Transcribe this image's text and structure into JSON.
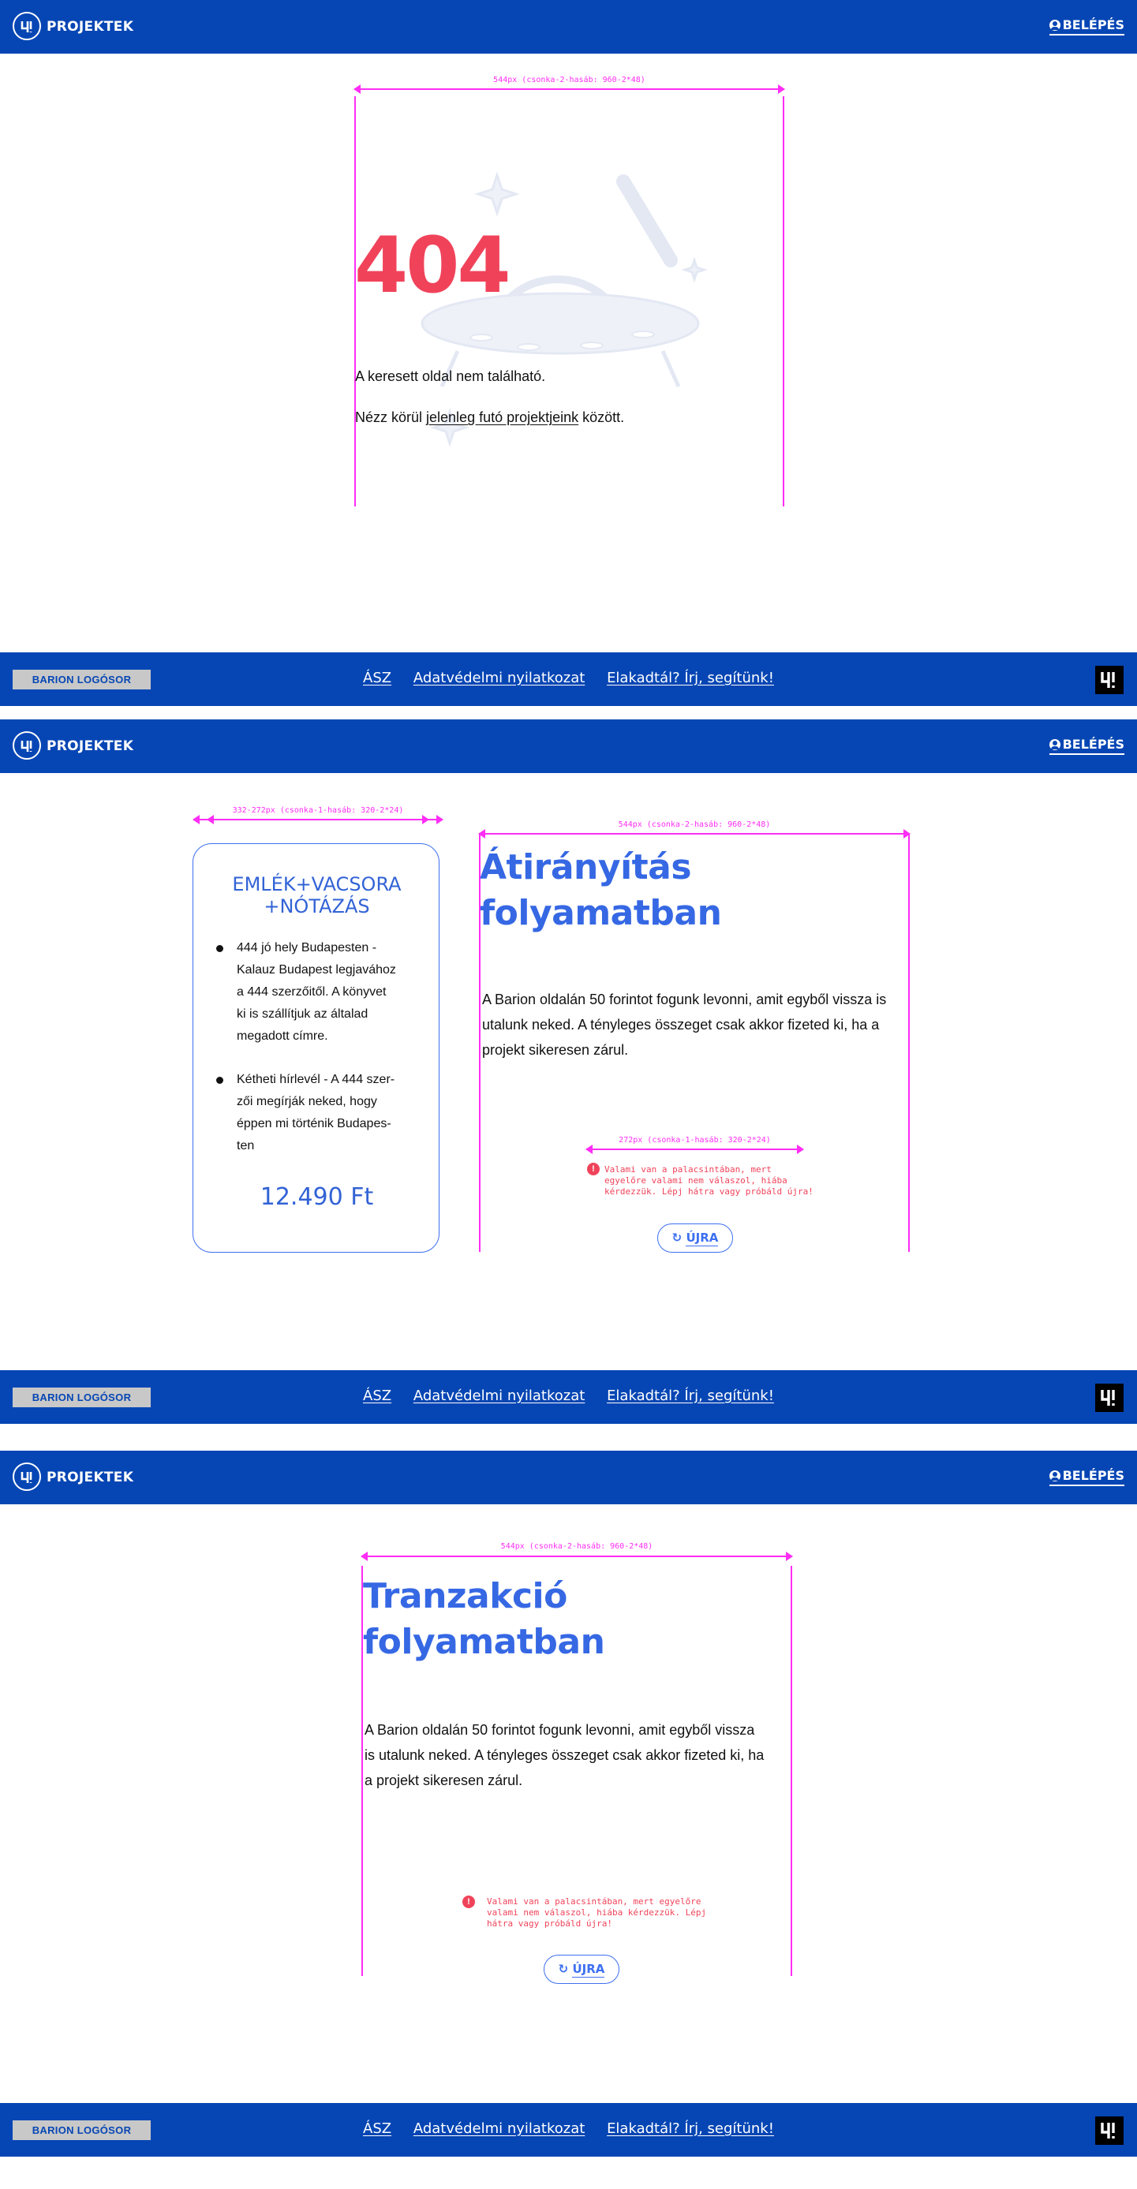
{
  "header": {
    "brand": "PROJEKTEK",
    "login": "BELÉPÉS",
    "logo_icon": "logo-icon",
    "user_icon": "user-icon"
  },
  "footer": {
    "barion": "BARION LOGÓSOR",
    "links": [
      "ÁSZ",
      "Adatvédelmi nyilatkozat",
      "Elakadtál? Írj, segítünk!"
    ],
    "badge_icon": "brand-badge-icon"
  },
  "guides": {
    "wide": "544px (csonka-2-hasáb: 960-2*48)",
    "narrow": "332-272px (csonka-1-hasáb: 320-2*24)",
    "small": "272px (csonka-1-hasáb: 320-2*24)"
  },
  "screen404": {
    "code": "404",
    "message": "A keresett oldal nem található.",
    "browse_prefix": "Nézz körül ",
    "browse_link": "jelenleg futó projektjeink",
    "browse_suffix": " között.",
    "illustration": "ufo-illustration"
  },
  "redirect": {
    "card_title_line1": "EMLÉK+VACSORA",
    "card_title_line2": "+NÓTÁZÁS",
    "bullets": [
      [
        "444 jó hely Budapesten -",
        "Kalauz Budapest legjavához",
        "a 444 szerzőitől. A könyvet",
        "ki is szállítjuk az általad",
        "megadott címre."
      ],
      [
        "Kétheti hírlevél - A 444 szer-",
        "zői megírják neked, hogy",
        "éppen mi történik Budapes-",
        "ten"
      ]
    ],
    "price": "12.490 Ft",
    "title_line1": "Átirányítás",
    "title_line2": "folyamatban",
    "body_lines": [
      "A Barion oldalán 50 forintot fogunk levonni, amit egyből vissza is",
      "utalunk neked. A tényleges összeget csak akkor fizeted ki, ha a",
      "projekt sikeresen zárul."
    ],
    "error_lines": [
      "Valami van a palacsintában, mert",
      "egyelőre valami nem válaszol, hiába",
      "kérdezzük. Lépj hátra vagy próbáld újra!"
    ],
    "retry": "ÚJRA"
  },
  "transaction": {
    "title_line1": "Tranzakció",
    "title_line2": "folyamatban",
    "body_lines": [
      "A Barion oldalán 50 forintot fogunk levonni, amit egyből vissza",
      "is utalunk neked. A tényleges összeget csak akkor fizeted ki, ha",
      "a projekt sikeresen zárul."
    ],
    "error_lines": [
      "Valami van a palacsintában, mert egyelőre",
      "valami nem válaszol, hiába kérdezzük. Lépj",
      "hátra vagy próbáld újra!"
    ],
    "retry": "ÚJRA"
  },
  "colors": {
    "brand_blue": "#0646b4",
    "accent_blue": "#3668e4",
    "error_red": "#f0435a",
    "guide_magenta": "#ff2df5"
  }
}
